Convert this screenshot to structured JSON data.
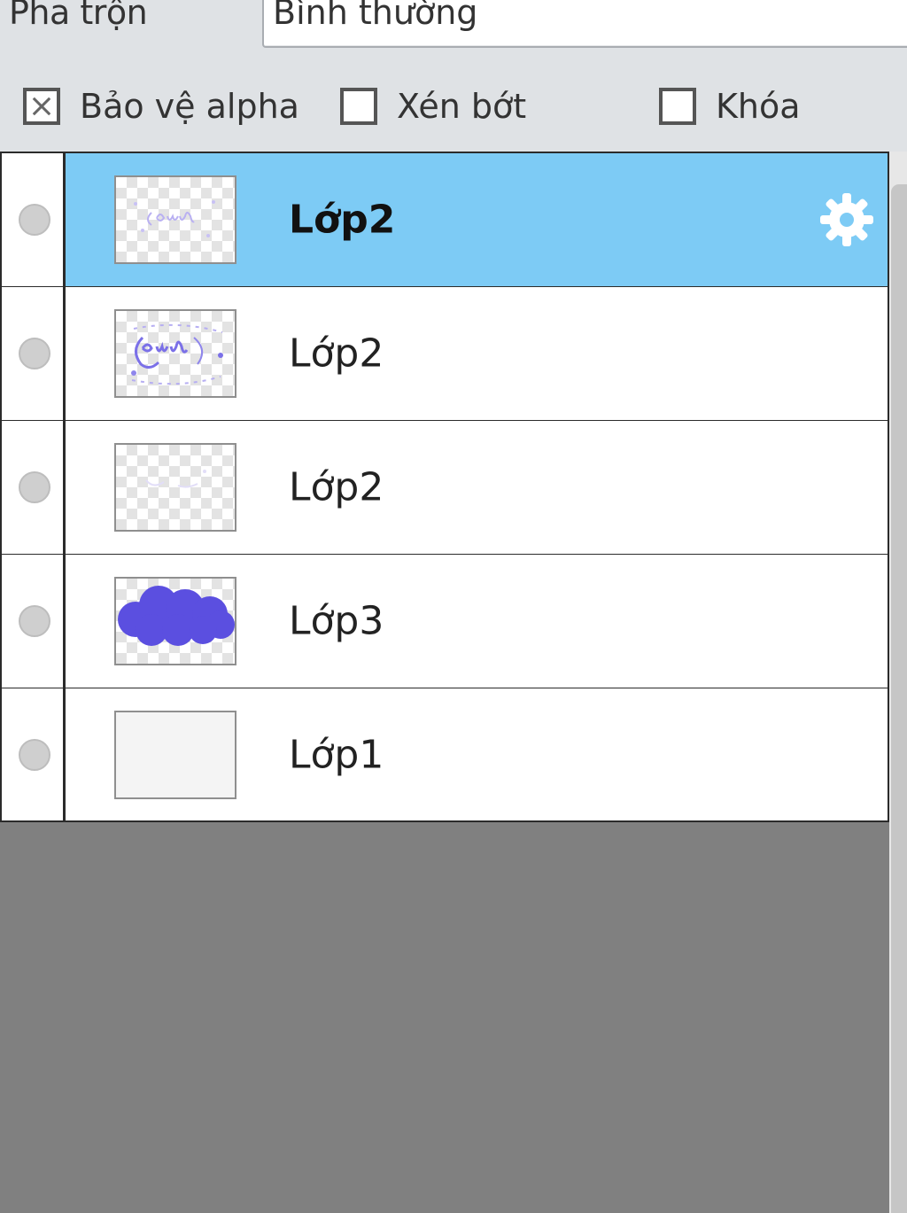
{
  "blend": {
    "label": "Pha trộn",
    "value": "Bình thường"
  },
  "options": [
    {
      "label": "Bảo vệ alpha",
      "checked": true
    },
    {
      "label": "Xén bớt",
      "checked": false
    },
    {
      "label": "Khóa",
      "checked": false
    }
  ],
  "layers": [
    {
      "name": "Lớp2",
      "selected": true,
      "thumbnail": "faint-lettering"
    },
    {
      "name": "Lớp2",
      "selected": false,
      "thumbnail": "lettering"
    },
    {
      "name": "Lớp2",
      "selected": false,
      "thumbnail": "faint-marks"
    },
    {
      "name": "Lớp3",
      "selected": false,
      "thumbnail": "cloud-fill"
    },
    {
      "name": "Lớp1",
      "selected": false,
      "thumbnail": "blank"
    }
  ],
  "icons": {
    "settings": "gear-icon",
    "visibility": "visibility-dot-icon"
  },
  "colors": {
    "selected_row": "#7dcbf5",
    "cloud_fill": "#5b4fe0",
    "empty_area": "#808080"
  }
}
